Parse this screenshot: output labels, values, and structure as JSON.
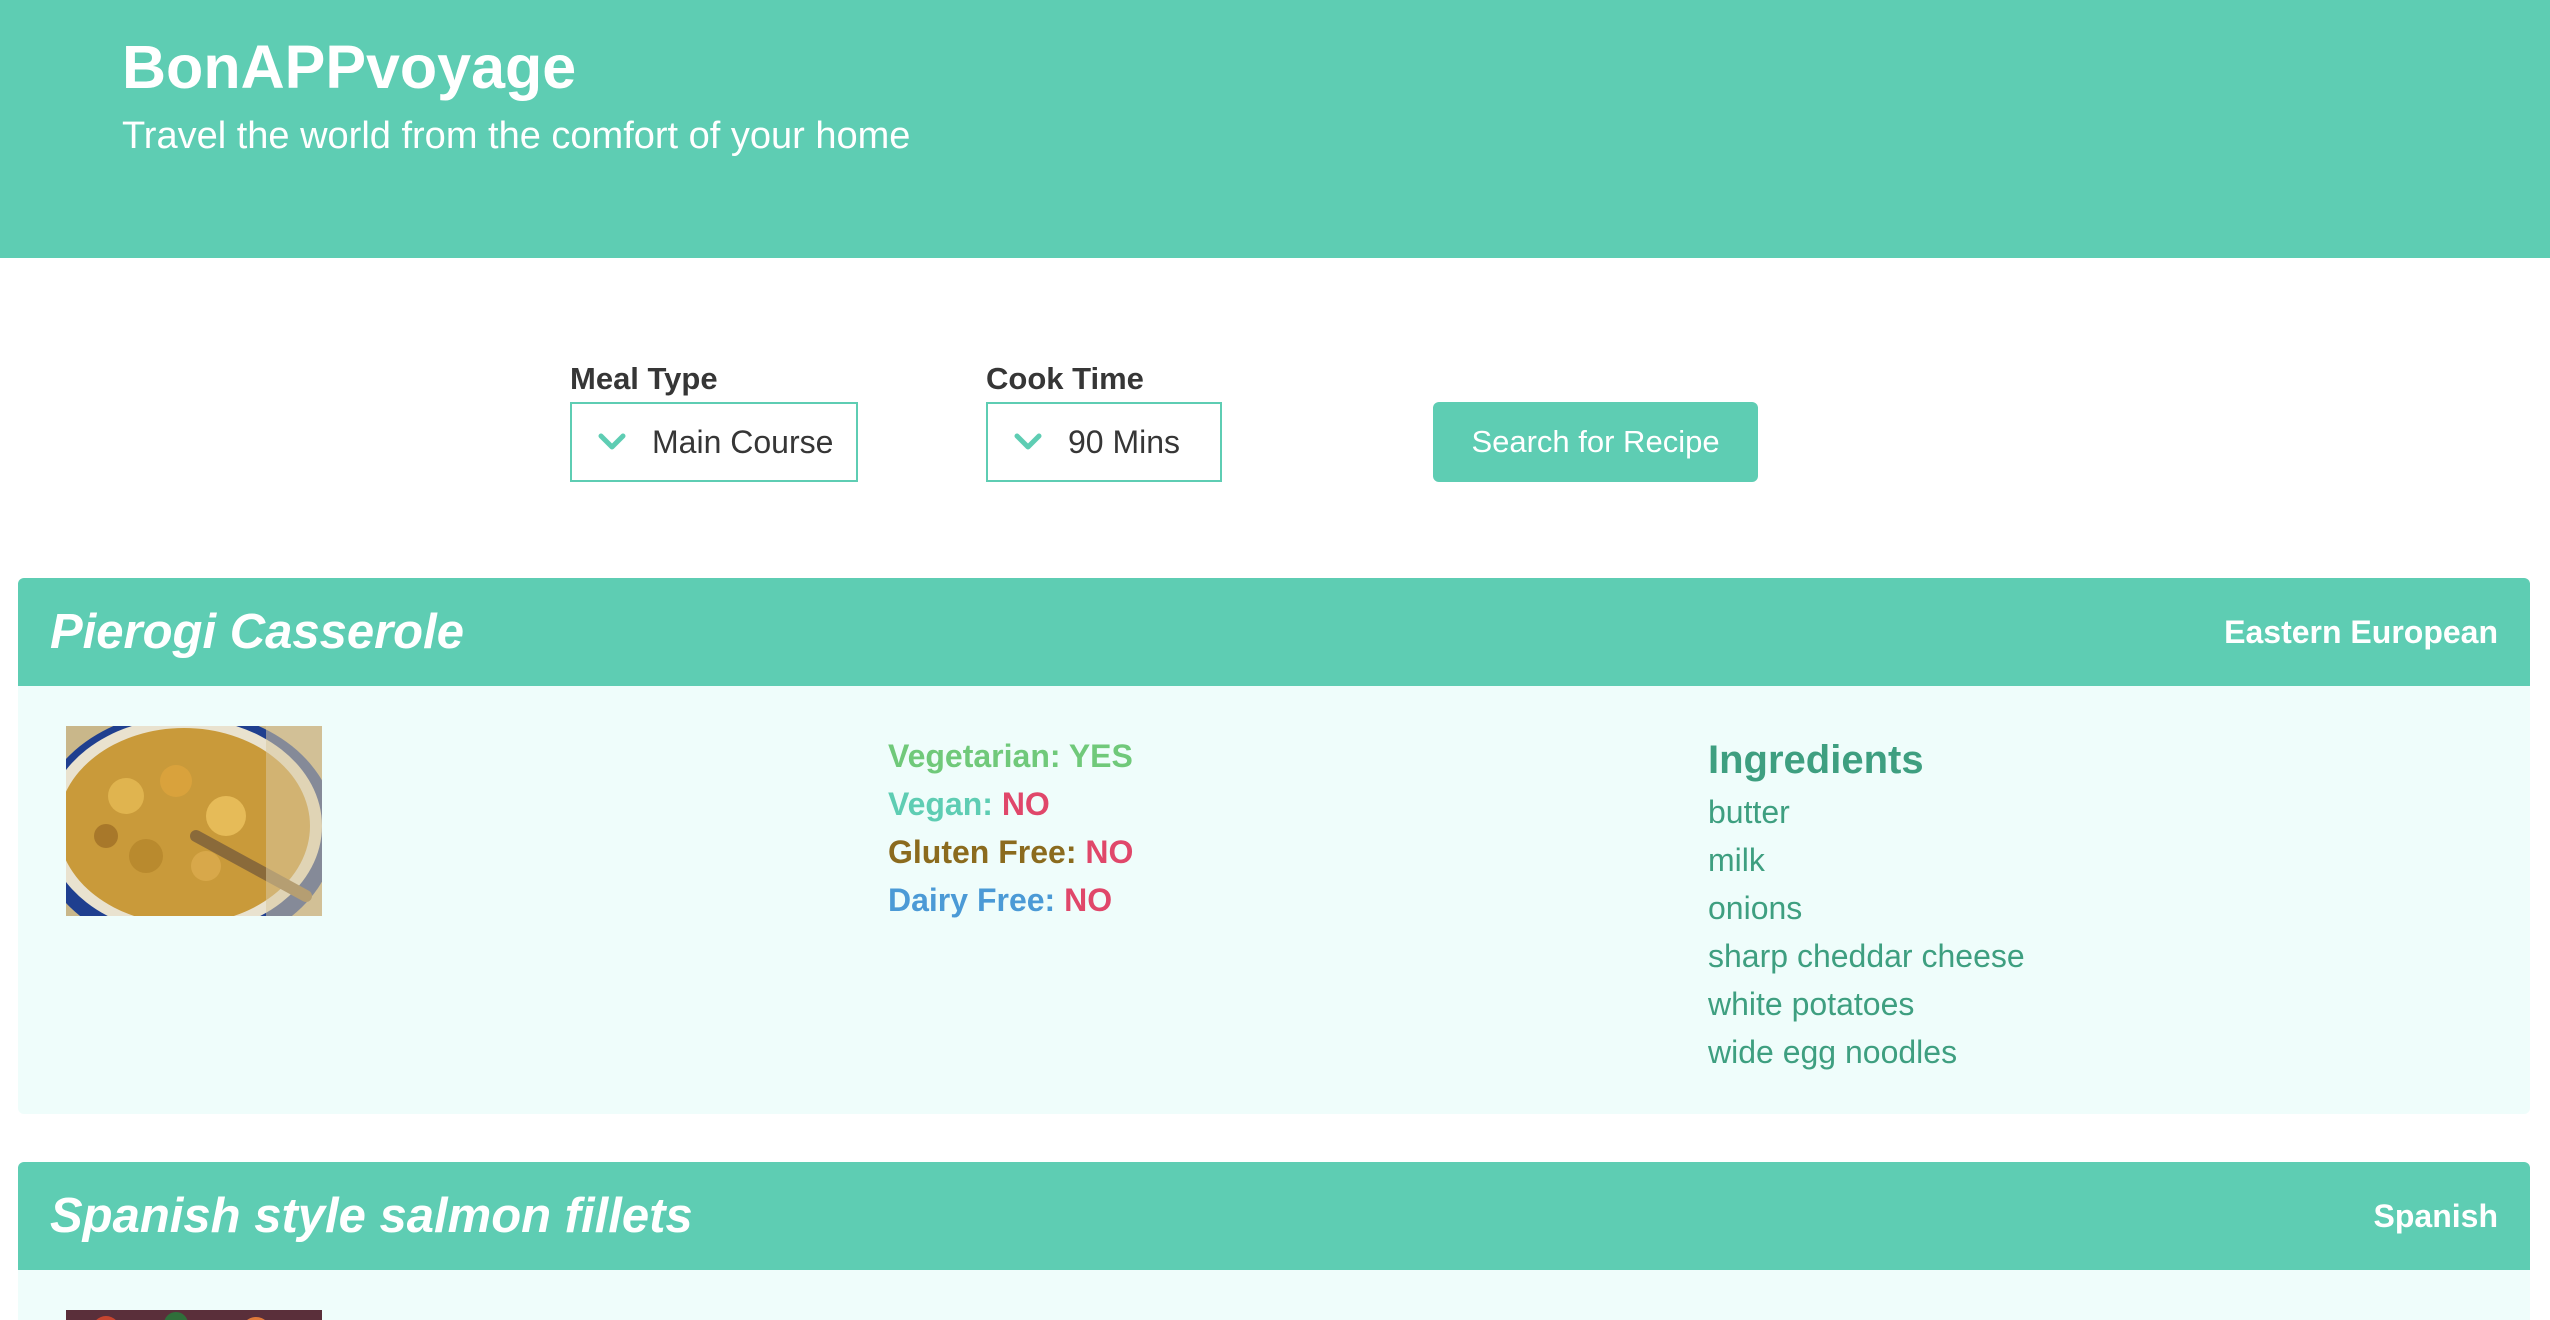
{
  "header": {
    "title": "BonAPPvoyage",
    "subtitle": "Travel the world from the comfort of your home"
  },
  "filters": {
    "meal_type_label": "Meal Type",
    "meal_type_value": "Main Course",
    "cook_time_label": "Cook Time",
    "cook_time_value": "90 Mins",
    "search_button": "Search for Recipe"
  },
  "recipes": [
    {
      "title": "Pierogi Casserole",
      "cuisine": "Eastern European",
      "vegetarian_label": "Vegetarian:",
      "vegetarian_value": "YES",
      "vegan_label": "Vegan:",
      "vegan_value": "NO",
      "gluten_label": "Gluten Free:",
      "gluten_value": "NO",
      "dairy_label": "Dairy Free:",
      "dairy_value": "NO",
      "ingredients_title": "Ingredients",
      "ingredients": [
        "butter",
        "milk",
        "onions",
        "sharp cheddar cheese",
        "white potatoes",
        "wide egg noodles"
      ]
    },
    {
      "title": "Spanish style salmon fillets",
      "cuisine": "Spanish"
    }
  ],
  "colors": {
    "accent": "#5ecdb3",
    "card_bg": "#effdfb",
    "no": "#e0476a",
    "vegetarian": "#70c97a",
    "gluten": "#8b6b1e",
    "dairy": "#4b9ad6",
    "ingredients": "#3e9f80"
  }
}
